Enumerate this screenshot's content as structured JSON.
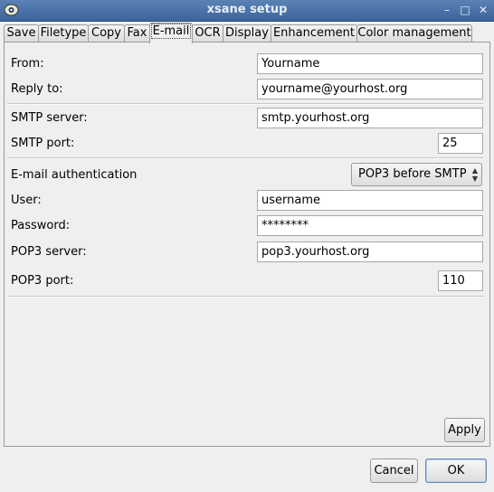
{
  "window": {
    "title": "xsane setup",
    "buttons": [
      "–",
      "□",
      "✕"
    ]
  },
  "tabs": [
    {
      "label": "Save"
    },
    {
      "label": "Filetype"
    },
    {
      "label": "Copy"
    },
    {
      "label": "Fax"
    },
    {
      "label": "E-mail",
      "active": true
    },
    {
      "label": "OCR"
    },
    {
      "label": "Display"
    },
    {
      "label": "Enhancement"
    },
    {
      "label": "Color management"
    }
  ],
  "email": {
    "from_label": "From:",
    "from_value": "Yourname",
    "reply_label": "Reply to:",
    "reply_value": "yourname@yourhost.org",
    "smtp_server_label": "SMTP server:",
    "smtp_server_value": "smtp.yourhost.org",
    "smtp_port_label": "SMTP port:",
    "smtp_port_value": "25",
    "auth_label": "E-mail authentication",
    "auth_value": "POP3 before SMTP",
    "user_label": "User:",
    "user_value": "username",
    "password_label": "Password:",
    "password_value": "********",
    "pop3_server_label": "POP3 server:",
    "pop3_server_value": "pop3.yourhost.org",
    "pop3_port_label": "POP3 port:",
    "pop3_port_value": "110"
  },
  "buttons": {
    "apply": "Apply",
    "cancel": "Cancel",
    "ok": "OK"
  }
}
